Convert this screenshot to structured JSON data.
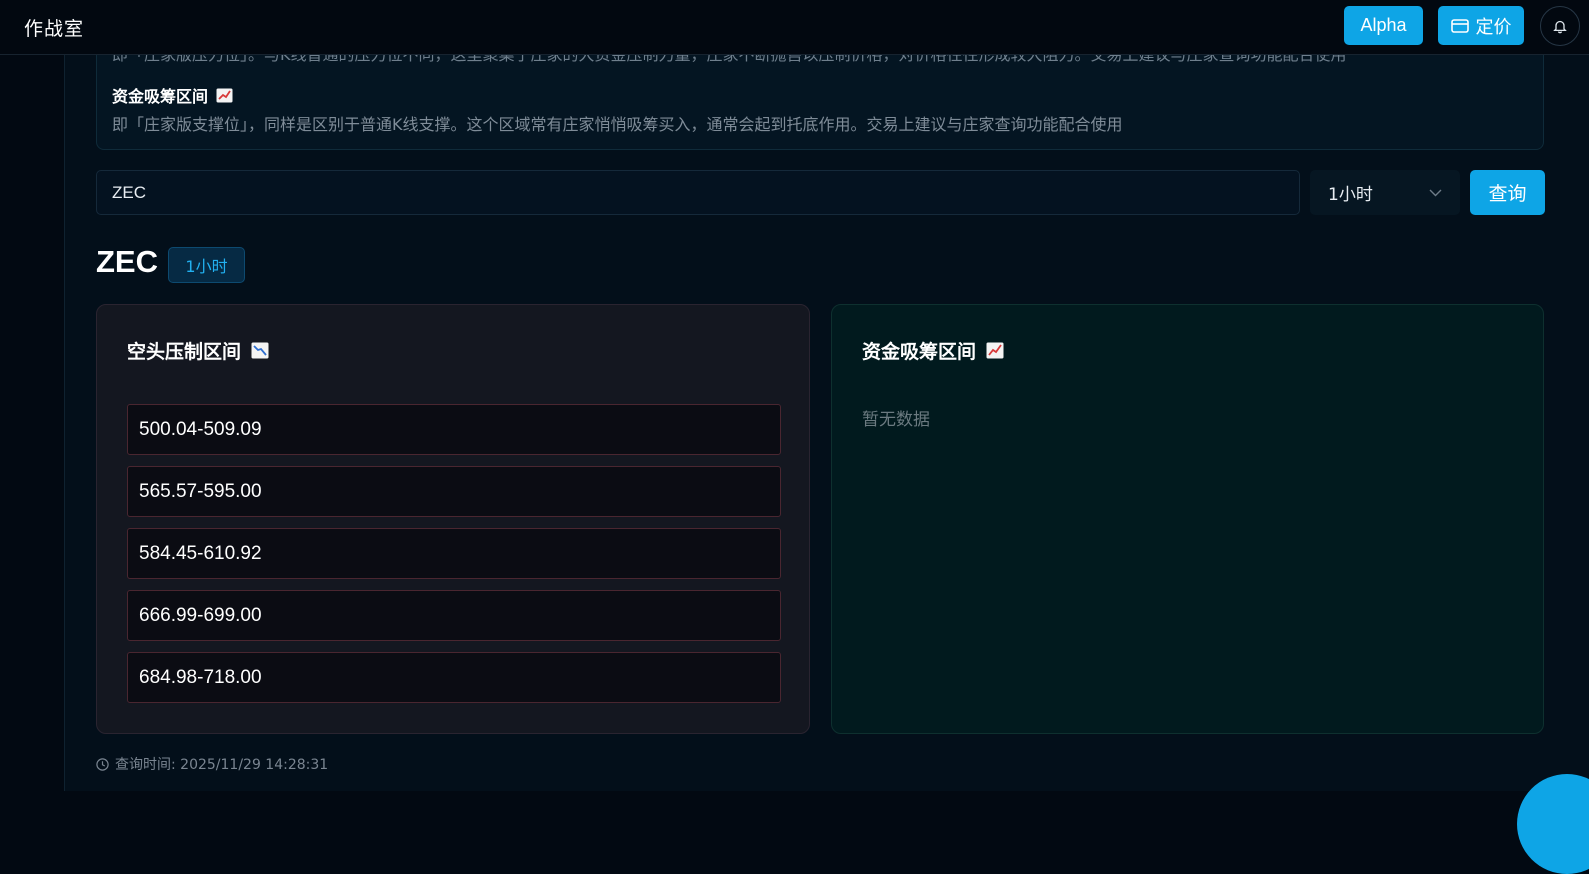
{
  "header": {
    "brand": "作战室",
    "alpha_label": "Alpha",
    "pricing_label": "定价"
  },
  "intro": {
    "cut_line": "即「庄家版压力位」。与K线普通的压力位不同，这里聚集了庄家的大资金压制力量，庄家不断抛售以压制价格，对价格往往形成较大阻力。交易上建议与庄家查询功能配合使用",
    "accumulate_heading": "资金吸筹区间",
    "accumulate_desc": "即「庄家版支撑位」，同样是区别于普通K线支撑。这个区域常有庄家悄悄吸筹买入，通常会起到托底作用。交易上建议与庄家查询功能配合使用"
  },
  "search": {
    "value": "ZEC",
    "timeframe": "1小时",
    "query_label": "查询"
  },
  "result": {
    "symbol": "ZEC",
    "timeframe": "1小时",
    "short_title": "空头压制区间",
    "long_title": "资金吸筹区间",
    "short_ranges": [
      "500.04-509.09",
      "565.57-595.00",
      "584.45-610.92",
      "666.99-699.00",
      "684.98-718.00"
    ],
    "long_empty": "暂无数据",
    "query_time": "查询时间: 2025/11/29 14:28:31"
  },
  "colors": {
    "accent": "#0ea5e6",
    "short_border": "#4a2630",
    "long_bg": "#011a1e"
  }
}
